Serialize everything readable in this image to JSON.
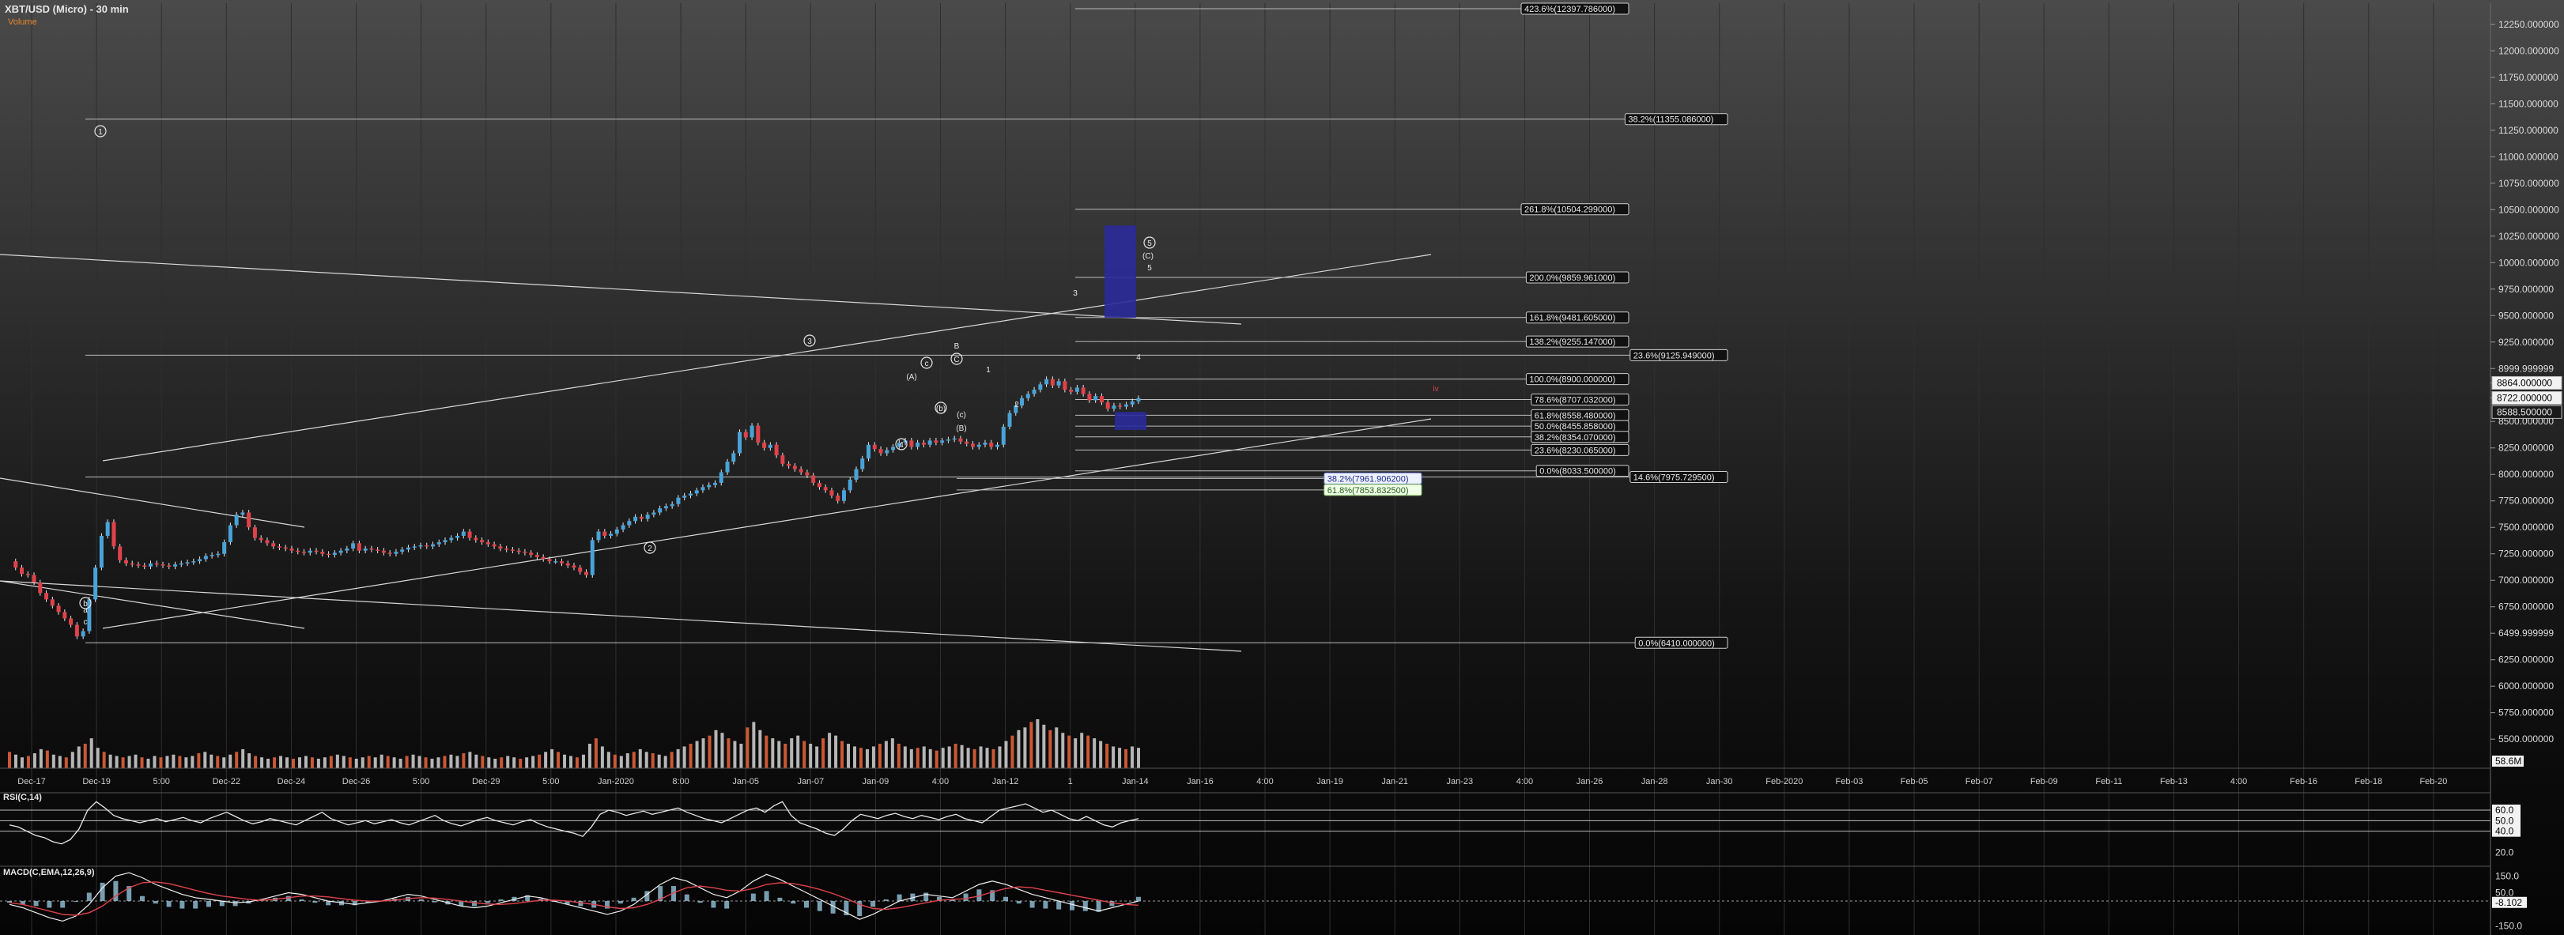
{
  "header": {
    "title": "XBT/USD (Micro) - 30 min",
    "subtitle": "Volume"
  },
  "colors": {
    "background_top": "#4a4a4a",
    "background_bottom": "#050505",
    "candle_up": "#4aa3d8",
    "candle_down": "#e0424a",
    "fib_line": "#bdbdbd",
    "target_box": "#2a2a9a",
    "wave_label": "#e6e6e6",
    "wave_red": "#e0424a"
  },
  "chart_data": [
    {
      "type": "line",
      "panel": "price",
      "title": "XBT/USD (Micro) - 30 min",
      "ylim": [
        5300,
        12450
      ],
      "y_ticks": [
        "5500.000000",
        "5750.000000",
        "6000.000000",
        "6250.000000",
        "6499.999999",
        "6750.000000",
        "7000.000000",
        "7250.000000",
        "7500.000000",
        "7750.000000",
        "8000.000000",
        "8250.000000",
        "8500.000000",
        "8722.000000",
        "8864.000000",
        "8999.999999",
        "9250.000000",
        "9500.000000",
        "9750.000000",
        "10000.000000",
        "10250.000000",
        "10500.000000",
        "10750.000000",
        "11000.000000",
        "11250.000000",
        "11500.000000",
        "11750.000000",
        "12000.000000",
        "12250.000000"
      ],
      "x_ticks": [
        "Dec-17",
        "Dec-19",
        "5:00",
        "Dec-22",
        "Dec-24",
        "Dec-26",
        "5:00",
        "Dec-29",
        "5:00",
        "Jan-2020",
        "8:00",
        "Jan-05",
        "Jan-07",
        "Jan-09",
        "4:00",
        "Jan-12",
        "1",
        "Jan-14",
        "Jan-16",
        "4:00",
        "Jan-19",
        "Jan-21",
        "Jan-23",
        "4:00",
        "Jan-26",
        "Jan-28",
        "Jan-30",
        "Feb-2020",
        "Feb-03",
        "Feb-05",
        "Feb-07",
        "Feb-09",
        "Feb-11",
        "Feb-13",
        "4:00",
        "Feb-16",
        "Feb-18",
        "Feb-20"
      ],
      "price_markers": [
        {
          "label": "8864.000000",
          "value": 8864,
          "style": "white"
        },
        {
          "label": "8722.000000",
          "value": 8722,
          "style": "white"
        },
        {
          "label": "8588.500000",
          "value": 8588.5,
          "style": "dark"
        }
      ],
      "series": [
        {
          "values": [
            7180,
            7120,
            7060,
            7050,
            6980,
            6880,
            6820,
            6760,
            6700,
            6640,
            6580,
            6470,
            6520,
            6820,
            7120,
            7420,
            7550,
            7320,
            7190,
            7160,
            7150,
            7140,
            7130,
            7160,
            7150,
            7140,
            7130,
            7150,
            7160,
            7170,
            7180,
            7200,
            7230,
            7240,
            7250,
            7360,
            7520,
            7620,
            7640,
            7500,
            7400,
            7380,
            7350,
            7320,
            7310,
            7300,
            7280,
            7270,
            7260,
            7280,
            7270,
            7250,
            7240,
            7260,
            7280,
            7300,
            7350,
            7280,
            7300,
            7290,
            7280,
            7260,
            7250,
            7270,
            7290,
            7310,
            7320,
            7330,
            7320,
            7340,
            7360,
            7380,
            7400,
            7420,
            7460,
            7400,
            7380,
            7360,
            7340,
            7320,
            7300,
            7290,
            7280,
            7270,
            7260,
            7240,
            7220,
            7200,
            7180,
            7180,
            7160,
            7140,
            7120,
            7080,
            7050,
            7380,
            7460,
            7420,
            7440,
            7480,
            7520,
            7560,
            7600,
            7580,
            7620,
            7640,
            7680,
            7700,
            7720,
            7780,
            7800,
            7820,
            7850,
            7880,
            7900,
            7920,
            8020,
            8120,
            8200,
            8400,
            8350,
            8460,
            8300,
            8250,
            8280,
            8180,
            8100,
            8080,
            8050,
            8020,
            7990,
            7920,
            7880,
            7850,
            7800,
            7750,
            7850,
            7950,
            8050,
            8150,
            8280,
            8240,
            8200,
            8230,
            8260,
            8300,
            8320,
            8260,
            8300,
            8280,
            8320,
            8300,
            8320,
            8330,
            8340,
            8310,
            8290,
            8260,
            8280,
            8300,
            8260,
            8280,
            8450,
            8580,
            8650,
            8720,
            8760,
            8800,
            8850,
            8900,
            8840,
            8880,
            8800,
            8780,
            8820,
            8760,
            8700,
            8740,
            8680,
            8620,
            8650,
            8640,
            8660,
            8690,
            8720
          ]
        }
      ],
      "fib_levels": [
        {
          "label": "423.6%(12397.786000)",
          "value": 12397.786
        },
        {
          "label": "38.2%(11355.086000)",
          "value": 11355.086
        },
        {
          "label": "261.8%(10504.299000)",
          "value": 10504.299
        },
        {
          "label": "200.0%(9859.961000)",
          "value": 9859.961
        },
        {
          "label": "161.8%(9481.605000)",
          "value": 9481.605
        },
        {
          "label": "138.2%(9255.147000)",
          "value": 9255.147
        },
        {
          "label": "23.6%(9125.949000)",
          "value": 9125.949
        },
        {
          "label": "100.0%(8900.000000)",
          "value": 8900
        },
        {
          "label": "78.6%(8707.032000)",
          "value": 8707.032
        },
        {
          "label": "61.8%(8558.480000)",
          "value": 8558.48
        },
        {
          "label": "50.0%(8455.858000)",
          "value": 8455.858
        },
        {
          "label": "38.2%(8354.070000)",
          "value": 8354.07
        },
        {
          "label": "23.6%(8230.065000)",
          "value": 8230.065
        },
        {
          "label": "0.0%(8033.500000)",
          "value": 8033.5
        },
        {
          "label": "14.6%(7975.729500)",
          "value": 7975.7295
        },
        {
          "label": "38.2%(7961.906200)",
          "value": 7961.9062
        },
        {
          "label": "61.8%(7853.832500)",
          "value": 7853.8325
        },
        {
          "label": "0.0%(6410.000000)",
          "value": 6410
        }
      ],
      "wave_labels": [
        "1",
        "2",
        "3",
        "4",
        "5",
        "(A)",
        "(B)",
        "(C)",
        "a",
        "b",
        "c",
        "B",
        "C",
        "1",
        "2",
        "3",
        "4",
        "5",
        "(b)",
        "(c)",
        "c",
        "iv"
      ]
    },
    {
      "type": "bar",
      "panel": "volume",
      "title": "Volume",
      "y_ticks": [
        "58.6M"
      ],
      "values": [
        12,
        10,
        8,
        9,
        11,
        14,
        13,
        10,
        9,
        8,
        12,
        16,
        18,
        22,
        15,
        12,
        10,
        9,
        8,
        9,
        10,
        8,
        7,
        9,
        8,
        9,
        10,
        9,
        8,
        9,
        11,
        12,
        10,
        9,
        8,
        10,
        12,
        14,
        11,
        9,
        8,
        7,
        8,
        9,
        8,
        7,
        8,
        9,
        8,
        7,
        8,
        9,
        10,
        9,
        8,
        7,
        8,
        9,
        8,
        10,
        9,
        8,
        7,
        9,
        10,
        9,
        8,
        7,
        8,
        9,
        10,
        9,
        11,
        12,
        10,
        9,
        8,
        7,
        8,
        9,
        8,
        7,
        8,
        9,
        10,
        12,
        14,
        12,
        10,
        9,
        8,
        10,
        18,
        22,
        16,
        12,
        10,
        9,
        11,
        12,
        14,
        12,
        11,
        10,
        9,
        12,
        14,
        16,
        18,
        20,
        22,
        24,
        28,
        26,
        22,
        20,
        18,
        30,
        34,
        28,
        24,
        22,
        20,
        18,
        22,
        24,
        20,
        18,
        16,
        22,
        26,
        24,
        20,
        18,
        16,
        15,
        14,
        16,
        18,
        20,
        22,
        18,
        16,
        14,
        15,
        16,
        14,
        13,
        15,
        16,
        18,
        17,
        15,
        14,
        16,
        15,
        14,
        16,
        20,
        24,
        28,
        30,
        34,
        36,
        32,
        28,
        30,
        26,
        24,
        22,
        26,
        24,
        22,
        20,
        18,
        16,
        15,
        14,
        16,
        15
      ]
    },
    {
      "type": "line",
      "panel": "rsi",
      "title": "RSI(C,14)",
      "y_ticks": [
        "60.0",
        "50.0",
        "40.0",
        "20.0"
      ],
      "ylim": [
        15,
        75
      ],
      "series": [
        {
          "values": [
            46,
            44,
            40,
            36,
            34,
            30,
            28,
            32,
            42,
            60,
            68,
            62,
            55,
            52,
            50,
            48,
            50,
            52,
            49,
            51,
            53,
            50,
            48,
            52,
            55,
            58,
            54,
            50,
            47,
            49,
            52,
            50,
            48,
            46,
            50,
            54,
            58,
            52,
            49,
            46,
            48,
            50,
            47,
            49,
            51,
            48,
            46,
            49,
            52,
            55,
            50,
            47,
            45,
            48,
            51,
            53,
            50,
            48,
            46,
            49,
            51,
            47,
            44,
            42,
            40,
            38,
            35,
            44,
            56,
            60,
            58,
            55,
            57,
            59,
            56,
            58,
            60,
            62,
            58,
            55,
            52,
            50,
            48,
            52,
            56,
            60,
            62,
            58,
            64,
            68,
            55,
            48,
            45,
            42,
            38,
            36,
            42,
            50,
            56,
            54,
            52,
            55,
            57,
            54,
            52,
            55,
            53,
            51,
            54,
            56,
            52,
            50,
            48,
            54,
            60,
            62,
            64,
            66,
            62,
            58,
            60,
            56,
            52,
            50,
            54,
            50,
            46,
            44,
            48,
            50,
            52
          ]
        }
      ]
    },
    {
      "type": "line",
      "panel": "macd",
      "title": "MACD(C,EMA,12,26,9)",
      "y_ticks": [
        "150.0",
        "50.0",
        "-8.102",
        "-150.0"
      ],
      "ylim": [
        -180,
        190
      ],
      "series": [
        {
          "values": [
            -20,
            -40,
            -70,
            -100,
            -120,
            -90,
            -20,
            80,
            150,
            170,
            140,
            100,
            70,
            40,
            20,
            10,
            0,
            -10,
            -5,
            10,
            30,
            50,
            40,
            20,
            0,
            -10,
            -20,
            -10,
            0,
            20,
            40,
            30,
            10,
            -10,
            -30,
            -40,
            -30,
            -10,
            10,
            30,
            20,
            0,
            -20,
            -40,
            -60,
            -80,
            -60,
            -20,
            40,
            100,
            140,
            120,
            80,
            40,
            20,
            60,
            120,
            160,
            130,
            90,
            50,
            10,
            -30,
            -70,
            -110,
            -80,
            -40,
            0,
            20,
            40,
            30,
            20,
            60,
            100,
            120,
            100,
            70,
            40,
            20,
            0,
            -20,
            -40,
            -60,
            -40,
            -20,
            0
          ]
        },
        {
          "values": [
            -10,
            -20,
            -40,
            -60,
            -80,
            -85,
            -70,
            -30,
            30,
            80,
            110,
            115,
            105,
            85,
            65,
            45,
            30,
            20,
            10,
            5,
            10,
            20,
            30,
            30,
            25,
            15,
            5,
            0,
            0,
            5,
            15,
            20,
            18,
            10,
            0,
            -10,
            -18,
            -20,
            -15,
            -5,
            5,
            5,
            0,
            -10,
            -20,
            -35,
            -45,
            -40,
            -20,
            10,
            50,
            80,
            90,
            80,
            65,
            60,
            75,
            100,
            110,
            105,
            90,
            70,
            45,
            15,
            -20,
            -45,
            -50,
            -40,
            -25,
            -10,
            5,
            10,
            15,
            30,
            55,
            75,
            85,
            80,
            65,
            50,
            35,
            20,
            5,
            -10,
            -20,
            -25
          ]
        }
      ]
    }
  ]
}
